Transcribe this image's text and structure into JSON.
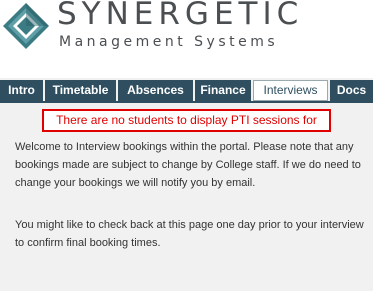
{
  "brand": {
    "name": "SYNERGETIC",
    "tagline": "Management Systems",
    "logo_icon": "diamond-logo-icon",
    "colors": {
      "text": "#4b4f52",
      "logo_teal": "#3b7b83"
    }
  },
  "tabs": [
    {
      "label": "Intro",
      "active": false
    },
    {
      "label": "Timetable",
      "active": false
    },
    {
      "label": "Absences",
      "active": false
    },
    {
      "label": "Finance",
      "active": false
    },
    {
      "label": "Interviews",
      "active": true
    },
    {
      "label": "Docs",
      "active": false
    }
  ],
  "colors": {
    "tab_bg": "#2f4f61",
    "alert": "#e00000",
    "page_bg": "#f1f1f1"
  },
  "alert": {
    "message": "There are no students to display PTI sessions for"
  },
  "content": {
    "intro_paragraph": "Welcome to Interview bookings within the portal. Please note that any bookings made are subject to change by College staff. If we do need to change your bookings we will notify you by email.",
    "reminder_paragraph": "You might like to check back at this page one day prior to your interview to confirm final booking times."
  }
}
